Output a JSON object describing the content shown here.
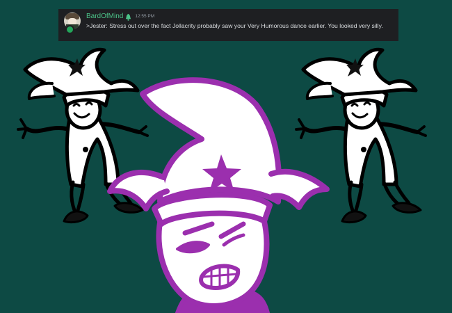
{
  "chat": {
    "username": "BardOfMind",
    "role_icon": "bell-crest-icon",
    "timestamp": "12:55 PM",
    "message": ">Jester: Stress out over the fact Jollacrity probably saw your Very Humorous dance earlier. You looked very silly."
  },
  "colors": {
    "background": "#0d4a44",
    "chat_background": "#1e1f22",
    "username": "#4bc187",
    "message_text": "#dbdee1",
    "timestamp": "#949ba4",
    "main_jester_outline": "#9b2fae"
  },
  "scene": {
    "left_figure": "dancing-jester-left",
    "right_figure": "dancing-jester-right",
    "main_figure": "stressed-jester"
  }
}
